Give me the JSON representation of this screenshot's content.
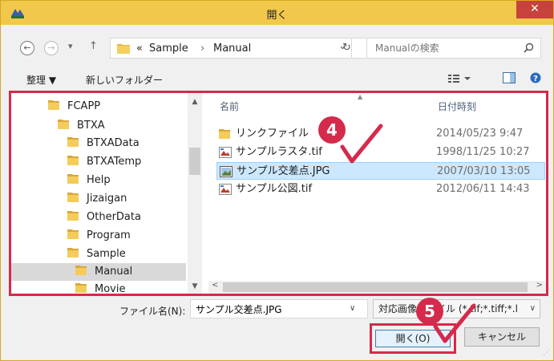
{
  "dialog": {
    "title": "開く",
    "close_label": "✕"
  },
  "address": {
    "overflow": "«",
    "crumbs": [
      "Sample",
      "Manual"
    ],
    "separator": "›",
    "dropdown": "⌄",
    "refresh": "↻"
  },
  "search": {
    "placeholder": "Manualの検索"
  },
  "toolbar": {
    "organize_label": "整理 ▼",
    "new_folder_label": "新しいフォルダー"
  },
  "tree": {
    "items": [
      {
        "label": "FCAPP"
      },
      {
        "label": "BTXA"
      },
      {
        "label": "BTXAData"
      },
      {
        "label": "BTXATemp"
      },
      {
        "label": "Help"
      },
      {
        "label": "Jizaigan"
      },
      {
        "label": "OtherData"
      },
      {
        "label": "Program"
      },
      {
        "label": "Sample"
      },
      {
        "label": "Manual"
      },
      {
        "label": "Movie"
      }
    ]
  },
  "files": {
    "col_name": "名前",
    "col_date": "日付時刻",
    "rows": [
      {
        "name": "リンクファイル",
        "date": "2014/05/23 9:47",
        "icon": "folder-shortcut-icon"
      },
      {
        "name": "サンプルラスタ.tif",
        "date": "1998/11/25 10:27",
        "icon": "tif-image-icon"
      },
      {
        "name": "サンプル交差点.JPG",
        "date": "2007/03/10 13:05",
        "icon": "jpg-image-icon"
      },
      {
        "name": "サンプル公図.tif",
        "date": "2012/06/11 14:43",
        "icon": "tif-image-icon"
      }
    ]
  },
  "bottom": {
    "filename_label": "ファイル名(N):",
    "filename_value": "サンプル交差点.JPG",
    "filetype_label": "対応画像ファイル (*.tif;*.tiff;*.l",
    "open_label": "開く(O)",
    "cancel_label": "キャンセル"
  },
  "annotations": {
    "step4": "4",
    "step5": "5",
    "color": "#d52a4b"
  }
}
